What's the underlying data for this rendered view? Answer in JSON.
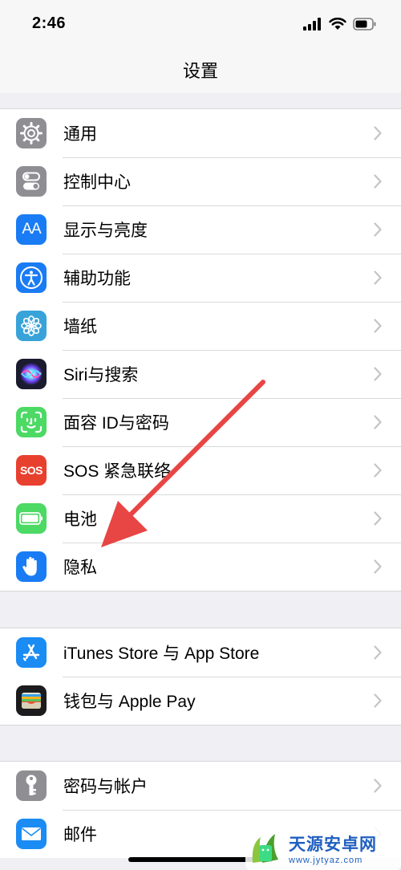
{
  "status_bar": {
    "time": "2:46"
  },
  "nav": {
    "title": "设置"
  },
  "groups": [
    {
      "items": [
        {
          "label": "通用",
          "icon": "gear-icon",
          "color": "#8e8e93"
        },
        {
          "label": "控制中心",
          "icon": "toggles-icon",
          "color": "#8e8e93"
        },
        {
          "label": "显示与亮度",
          "icon": "text-size-icon",
          "icon_text": "AA",
          "color": "#1a7cf4"
        },
        {
          "label": "辅助功能",
          "icon": "accessibility-icon",
          "color": "#1a7cf4"
        },
        {
          "label": "墙纸",
          "icon": "flower-icon",
          "color": "#38a3d9"
        },
        {
          "label": "Siri与搜索",
          "icon": "siri-icon",
          "color": "#1b1b2f"
        },
        {
          "label": "面容 ID与密码",
          "icon": "face-id-icon",
          "color": "#4cd964"
        },
        {
          "label": "SOS 紧急联络",
          "icon": "sos-icon",
          "icon_text": "SOS",
          "color": "#e8402f"
        },
        {
          "label": "电池",
          "icon": "battery-icon",
          "color": "#4cd964"
        },
        {
          "label": "隐私",
          "icon": "hand-icon",
          "color": "#1a7cf4"
        }
      ]
    },
    {
      "items": [
        {
          "label": "iTunes Store 与 App Store",
          "icon": "app-store-icon",
          "color": "#1a8cf4"
        },
        {
          "label": "钱包与 Apple Pay",
          "icon": "wallet-icon",
          "color": "#1c1c1e"
        }
      ]
    },
    {
      "items": [
        {
          "label": "密码与帐户",
          "icon": "key-icon",
          "color": "#8e8e93"
        },
        {
          "label": "邮件",
          "icon": "mail-icon",
          "color": "#1a8cf4"
        }
      ]
    }
  ],
  "annotation": {
    "arrow_color": "#e84545"
  },
  "watermark": {
    "title": "天源安卓网",
    "url": "www.jytyaz.com"
  }
}
